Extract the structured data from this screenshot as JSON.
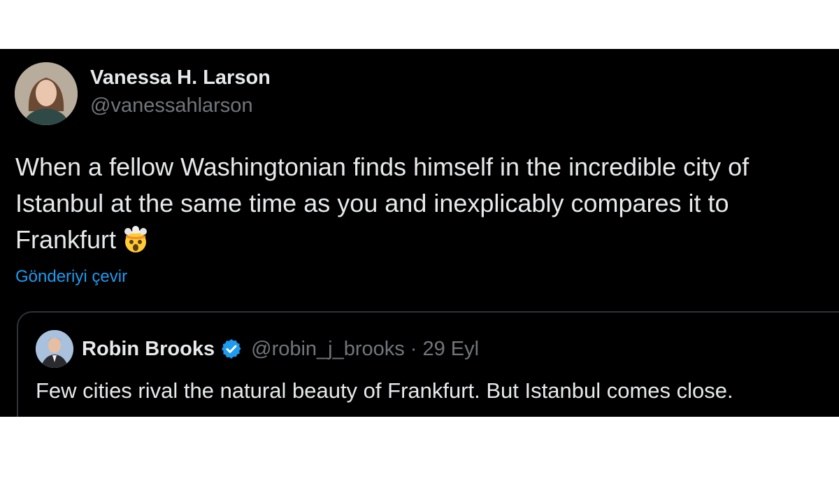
{
  "tweet": {
    "author": {
      "display_name": "Vanessa H. Larson",
      "handle": "@vanessahlarson"
    },
    "text": "When a fellow Washingtonian finds himself in the incredible city of Istanbul at the same time as you and inexplicably compares it to Frankfurt",
    "emoji": "exploding-head-icon",
    "translate_label": "Gönderiyi çevir"
  },
  "quote": {
    "author": {
      "display_name": "Robin Brooks",
      "handle": "@robin_j_brooks",
      "verified": true
    },
    "separator": "·",
    "date": "29 Eyl",
    "text": "Few cities rival the natural beauty of Frankfurt. But Istanbul comes close."
  },
  "colors": {
    "background": "#000000",
    "text": "#e7e9ea",
    "muted": "#71767b",
    "link": "#1d9bf0",
    "border": "#2f3336",
    "verified": "#1d9bf0"
  }
}
